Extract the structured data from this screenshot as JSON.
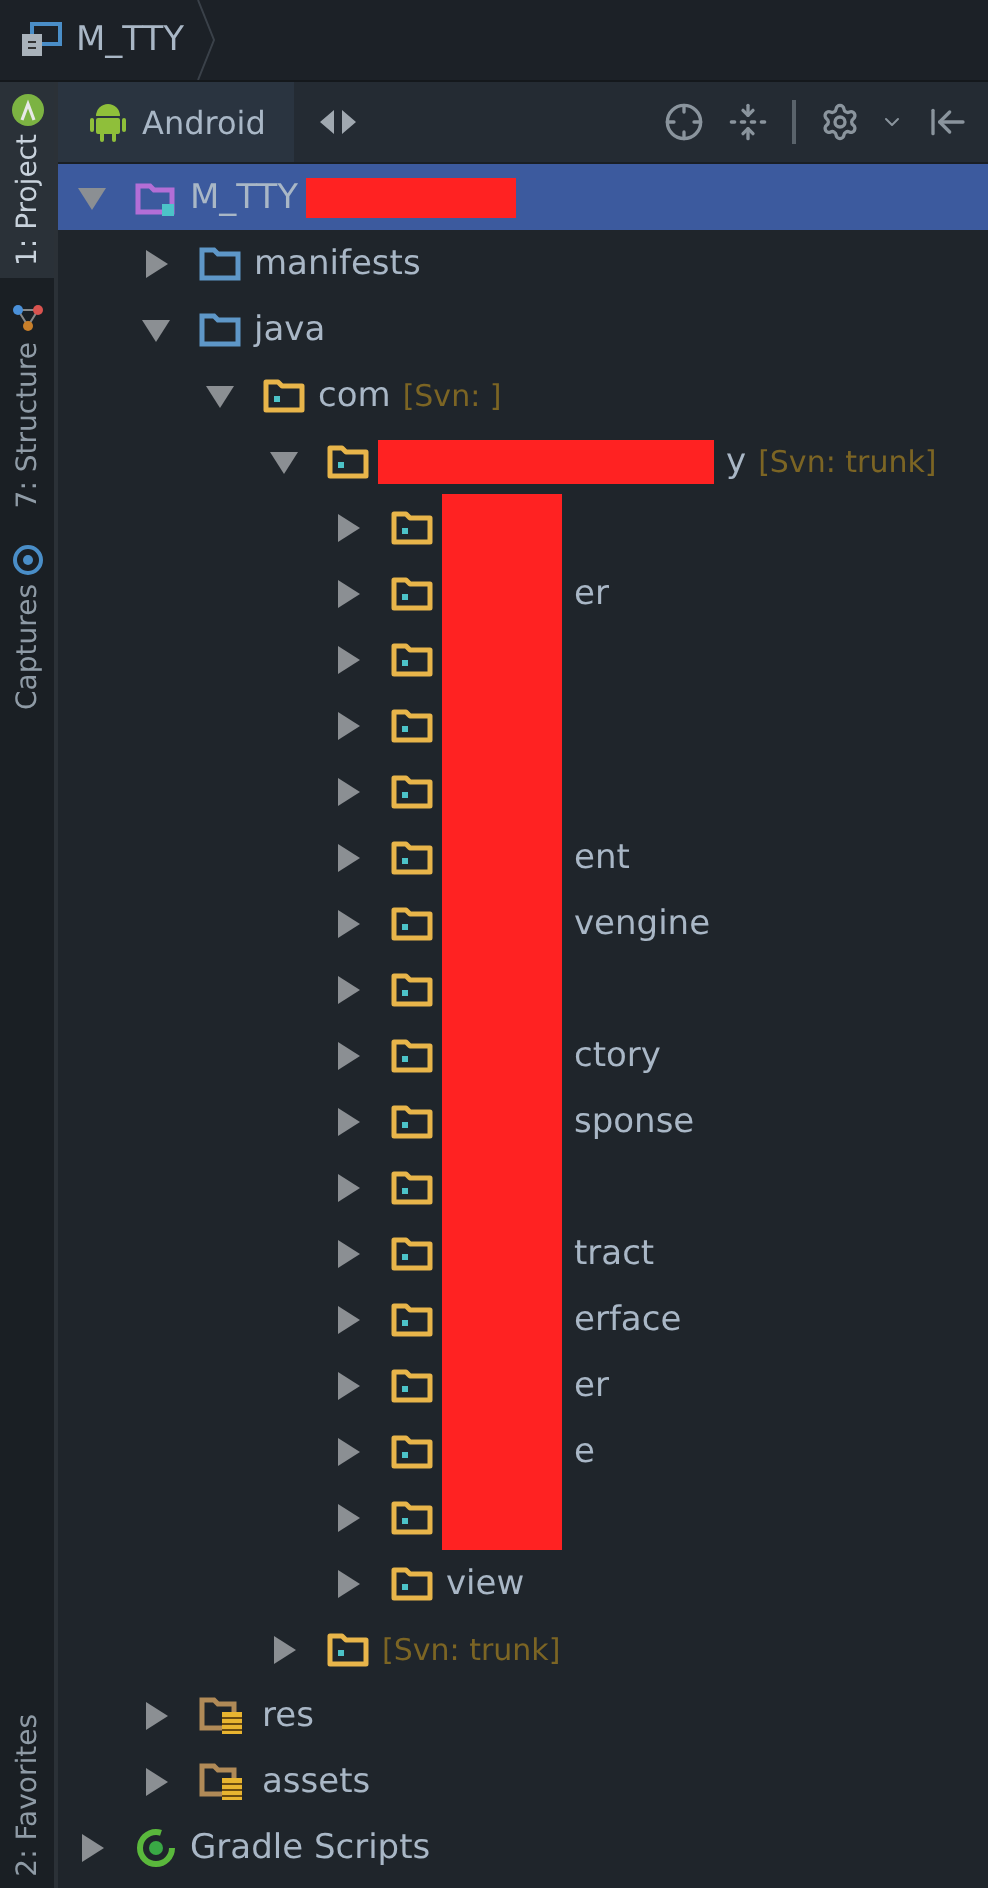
{
  "breadcrumb": {
    "title": "M_TTY"
  },
  "side_tabs": [
    {
      "label": "1: Project",
      "selected": true,
      "kind": "project"
    },
    {
      "label": "7: Structure",
      "selected": false,
      "kind": "structure"
    },
    {
      "label": "Captures",
      "selected": false,
      "kind": "captures"
    }
  ],
  "side_tabs_bottom": [
    {
      "label": "2: Favorites",
      "selected": false
    }
  ],
  "view_selector": {
    "label": "Android"
  },
  "tree": [
    {
      "label": "M_TTY",
      "kind": "module",
      "expanded": true,
      "selected": true,
      "redacted": true,
      "children": [
        {
          "label": "manifests",
          "kind": "folder",
          "expanded": false,
          "selected": false
        },
        {
          "label": "java",
          "kind": "folder",
          "expanded": true,
          "selected": false,
          "children": [
            {
              "label": "com",
              "svn": "[Svn: ]",
              "kind": "package",
              "expanded": true,
              "selected": false,
              "children": [
                {
                  "label": "y",
                  "svn": "[Svn: trunk]",
                  "kind": "package",
                  "expanded": true,
                  "selected": false,
                  "redacted": true,
                  "children": [
                    {
                      "kind": "package",
                      "expanded": false,
                      "selected": false,
                      "redacted": true
                    },
                    {
                      "label": "er",
                      "kind": "package",
                      "expanded": false,
                      "selected": false,
                      "redacted": true
                    },
                    {
                      "kind": "package",
                      "expanded": false,
                      "selected": false,
                      "redacted": true
                    },
                    {
                      "kind": "package",
                      "expanded": false,
                      "selected": false,
                      "redacted": true
                    },
                    {
                      "kind": "package",
                      "expanded": false,
                      "selected": false,
                      "redacted": true
                    },
                    {
                      "label": "ent",
                      "kind": "package",
                      "expanded": false,
                      "selected": false,
                      "redacted": true
                    },
                    {
                      "label": "vengine",
                      "kind": "package",
                      "expanded": false,
                      "selected": false,
                      "redacted": true
                    },
                    {
                      "kind": "package",
                      "expanded": false,
                      "selected": false,
                      "redacted": true
                    },
                    {
                      "label": "ctory",
                      "kind": "package",
                      "expanded": false,
                      "selected": false,
                      "redacted": true
                    },
                    {
                      "label": "sponse",
                      "kind": "package",
                      "expanded": false,
                      "selected": false,
                      "redacted": true
                    },
                    {
                      "kind": "package",
                      "expanded": false,
                      "selected": false,
                      "redacted": true
                    },
                    {
                      "label": "tract",
                      "kind": "package",
                      "expanded": false,
                      "selected": false,
                      "redacted": true
                    },
                    {
                      "label": "erface",
                      "kind": "package",
                      "expanded": false,
                      "selected": false,
                      "redacted": true
                    },
                    {
                      "label": "er",
                      "kind": "package",
                      "expanded": false,
                      "selected": false,
                      "redacted": true
                    },
                    {
                      "label": "e",
                      "kind": "package",
                      "expanded": false,
                      "selected": false,
                      "redacted": true
                    },
                    {
                      "kind": "package",
                      "expanded": false,
                      "selected": false,
                      "redacted": true
                    },
                    {
                      "label": "view",
                      "kind": "package",
                      "expanded": false,
                      "selected": false
                    }
                  ]
                },
                {
                  "svn": "[Svn: trunk]",
                  "kind": "package",
                  "expanded": false,
                  "selected": false
                }
              ]
            }
          ]
        },
        {
          "label": "res",
          "kind": "resources",
          "expanded": false,
          "selected": false
        },
        {
          "label": "assets",
          "kind": "resources",
          "expanded": false,
          "selected": false
        }
      ]
    },
    {
      "label": "Gradle Scripts",
      "kind": "gradle",
      "expanded": false,
      "selected": false
    }
  ]
}
